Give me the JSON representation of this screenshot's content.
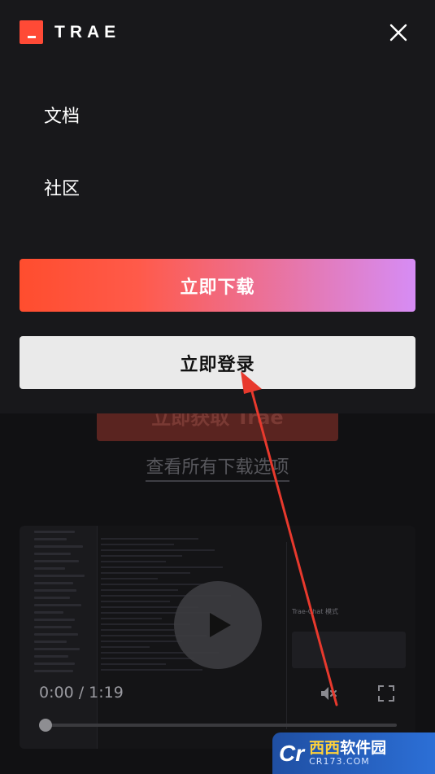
{
  "header": {
    "logo_text": "TRAE",
    "close_icon": "close-icon"
  },
  "menu": {
    "items": [
      {
        "label": "文档"
      },
      {
        "label": "社区"
      }
    ],
    "download_button": "立即下载",
    "login_button": "立即登录"
  },
  "page": {
    "ghost_download_button": "立即获取 Trae",
    "all_options_link": "查看所有下载选项"
  },
  "video": {
    "panel_title": "Trae-Chat 模式",
    "play_icon": "play-icon",
    "time": "0:00 / 1:19",
    "mute_icon": "muted-speaker-icon",
    "fullscreen_icon": "fullscreen-icon",
    "progress": 0
  },
  "colors": {
    "accent": "#ff4a36",
    "arrow": "#e8392d"
  },
  "watermark": {
    "logo": "Cr",
    "title_part1": "西西",
    "title_part2": "软件园",
    "site": "CR173.COM"
  }
}
